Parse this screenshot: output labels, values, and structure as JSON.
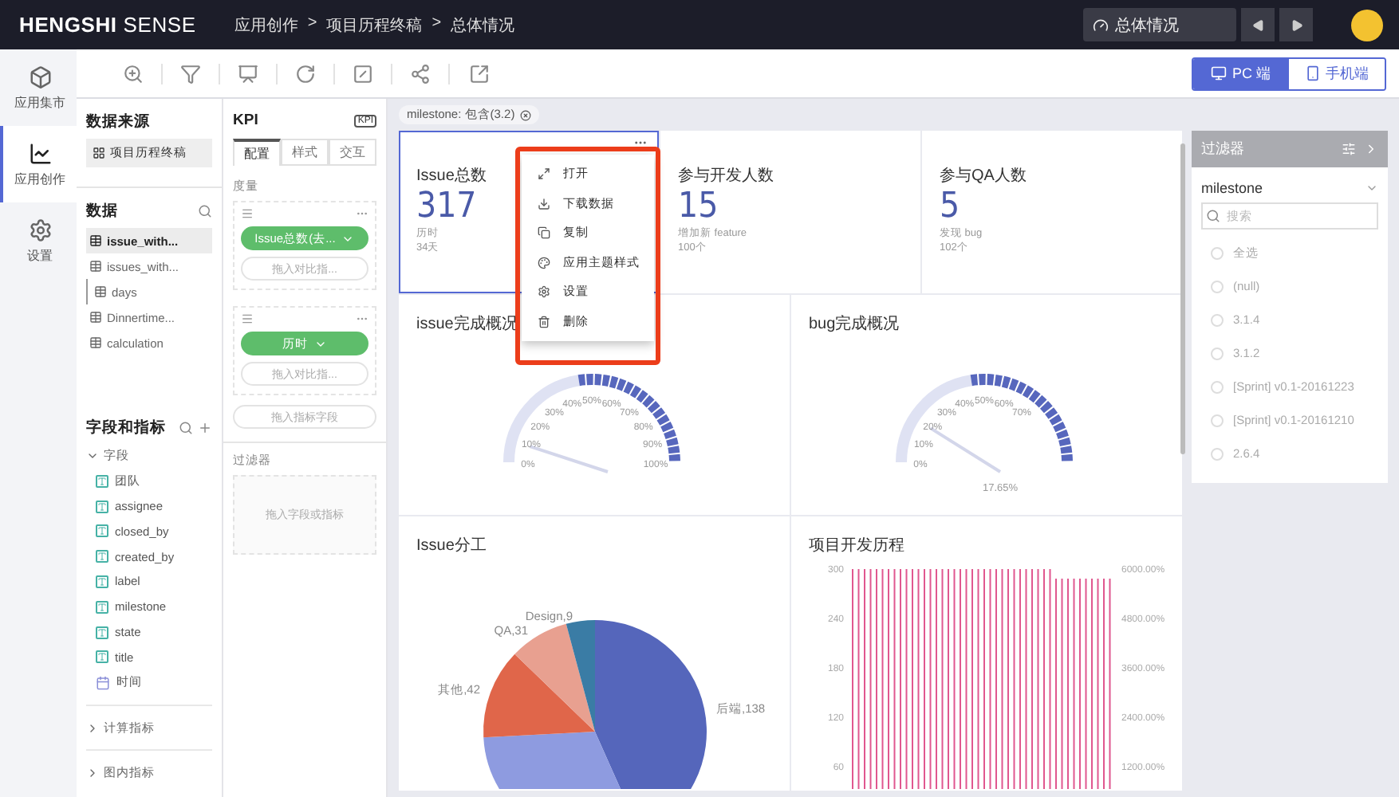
{
  "topbar": {
    "logo_bold": "HENGSHI",
    "logo_light": "SENSE",
    "breadcrumb": [
      "应用创作",
      "项目历程终稿",
      "总体情况"
    ],
    "separator": ">",
    "dashboard_select": "总体情况"
  },
  "nav": [
    {
      "label": "应用集市",
      "selected": false
    },
    {
      "label": "应用创作",
      "selected": true
    },
    {
      "label": "设置",
      "selected": false
    }
  ],
  "view_switch": [
    {
      "label": "PC 端",
      "selected": true
    },
    {
      "label": "手机端",
      "selected": false
    }
  ],
  "data_panel": {
    "source_title": "数据来源",
    "source": "项目历程终稿",
    "data_title": "数据",
    "datasets": [
      {
        "label": "issue_with...",
        "selected": true
      },
      {
        "label": "issues_with...",
        "selected": false,
        "children": [
          {
            "label": "days",
            "selected": false
          }
        ]
      },
      {
        "label": "Dinnertime...",
        "selected": false
      },
      {
        "label": "calculation",
        "selected": false
      }
    ],
    "fields_title": "字段和指标",
    "groups": [
      {
        "label": "字段",
        "expanded": true,
        "items": [
          {
            "label": "团队",
            "kind": "text"
          },
          {
            "label": "assignee",
            "kind": "text"
          },
          {
            "label": "closed_by",
            "kind": "text"
          },
          {
            "label": "created_by",
            "kind": "text"
          },
          {
            "label": "label",
            "kind": "text"
          },
          {
            "label": "milestone",
            "kind": "text"
          },
          {
            "label": "state",
            "kind": "text"
          },
          {
            "label": "title",
            "kind": "text"
          },
          {
            "label": "时间",
            "kind": "date"
          }
        ]
      },
      {
        "label": "计算指标",
        "expanded": false
      },
      {
        "label": "图内指标",
        "expanded": false
      }
    ]
  },
  "kpi_panel": {
    "title": "KPI",
    "badge": "KPI",
    "tabs": [
      {
        "label": "配置",
        "selected": true
      },
      {
        "label": "样式",
        "selected": false
      },
      {
        "label": "交互",
        "selected": false
      }
    ],
    "measure_title": "度量",
    "measures": [
      {
        "pill": "Issue总数(去...",
        "compare": "拖入对比指..."
      },
      {
        "pill": "历时",
        "compare": "拖入对比指..."
      }
    ],
    "add_measure": "拖入指标字段",
    "filter_title": "过滤器",
    "filter_drop": "拖入字段或指标"
  },
  "dashboard": {
    "chip": "milestone: 包含(3.2)",
    "kpis": [
      {
        "title": "Issue总数",
        "value": "317",
        "sub": [
          "历时",
          "34天"
        ],
        "selected": true
      },
      {
        "title": "参与开发人数",
        "value": "15",
        "sub": [
          "增加新 feature",
          "100个"
        ],
        "selected": false
      },
      {
        "title": "参与QA人数",
        "value": "5",
        "sub": [
          "发现 bug",
          "102个"
        ],
        "selected": false
      }
    ],
    "gauges": [
      {
        "title": "issue完成概况",
        "ticks": [
          "0%",
          "10%",
          "20%",
          "30%",
          "40%",
          "50%",
          "60%",
          "70%",
          "80%",
          "90%",
          "100%"
        ]
      },
      {
        "title": "bug完成概况",
        "ticks": [
          "0%",
          "10%",
          "20%",
          "30%",
          "40%",
          "50%",
          "60%",
          "70%"
        ],
        "reading": "17.65%"
      }
    ],
    "pie": {
      "title": "Issue分工",
      "labels": [
        "后端,138",
        "其他,42",
        "QA,31",
        "Design,9"
      ]
    },
    "history": {
      "title": "项目开发历程",
      "left_ticks": [
        "300",
        "240",
        "180",
        "120",
        "60"
      ],
      "right_ticks": [
        "6000.00%",
        "4800.00%",
        "3600.00%",
        "2400.00%",
        "1200.00%"
      ]
    },
    "menu": [
      "打开",
      "下载数据",
      "复制",
      "应用主题样式",
      "设置",
      "删除"
    ]
  },
  "filter_panel": {
    "title": "过滤器",
    "field": "milestone",
    "placeholder": "搜索",
    "options": [
      {
        "label": "全选",
        "selected": false
      },
      {
        "label": "(null)",
        "selected": false
      },
      {
        "label": "3.1.4",
        "selected": false
      },
      {
        "label": "3.1.2",
        "selected": false
      },
      {
        "label": "[Sprint] v0.1-20161223",
        "selected": false
      },
      {
        "label": "[Sprint] v0.1-20161210",
        "selected": false
      },
      {
        "label": "2.6.4",
        "selected": false
      }
    ]
  }
}
